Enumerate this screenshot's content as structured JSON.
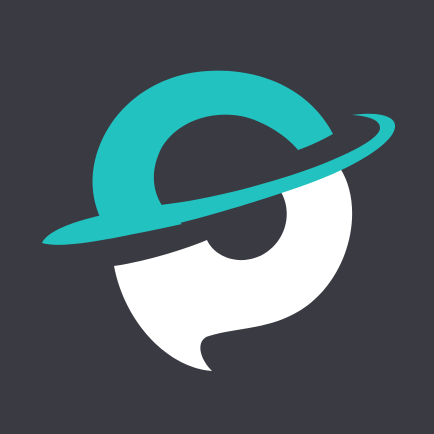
{
  "icon": {
    "name": "planet-chat-logo-icon",
    "colors": {
      "background": "#3a3a42",
      "accent": "#21c2c0",
      "primary": "#ffffff"
    }
  }
}
